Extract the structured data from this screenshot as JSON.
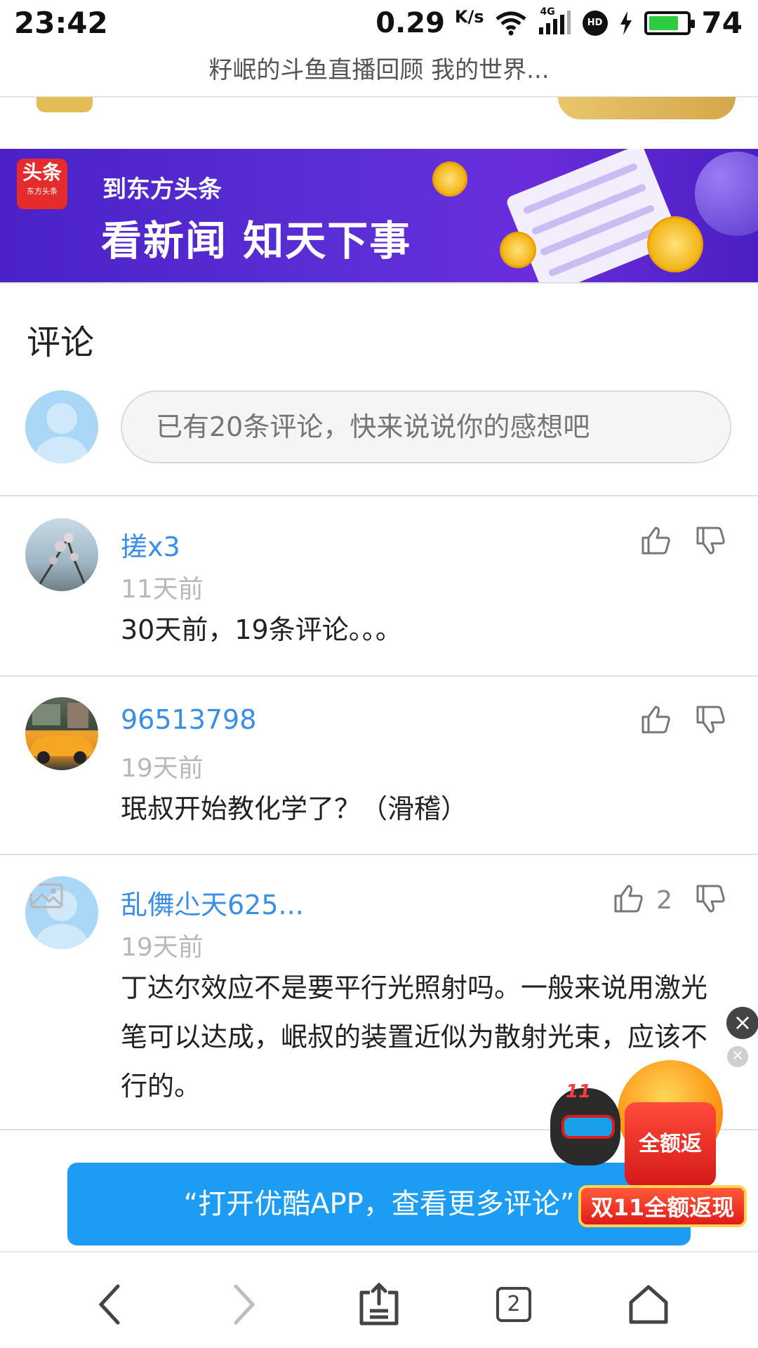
{
  "status_bar": {
    "time": "23:42",
    "network_speed": "0.29",
    "speed_unit_top": "K",
    "speed_unit_bottom": "/s",
    "network_type": "4G",
    "hd_badge": "HD",
    "battery_level": "74",
    "icons": [
      "wifi-icon",
      "signal-icon",
      "hd-icon",
      "charging-icon",
      "battery-icon"
    ]
  },
  "page": {
    "title": "籽岷的斗鱼直播回顾 我的世界..."
  },
  "banner": {
    "logo_text": "头条",
    "logo_subtext": "东方头条",
    "subtitle": "到东方头条",
    "headline": "看新闻 知天下事"
  },
  "comments_section": {
    "title": "评论",
    "input_placeholder": "已有20条评论，快来说说你的感想吧",
    "items": [
      {
        "username": "搓x3",
        "time": "11天前",
        "text": "30天前，19条评论。。。",
        "likes": ""
      },
      {
        "username": "96513798",
        "time": "19天前",
        "text": "珉叔开始教化学了？（滑稽）",
        "likes": ""
      },
      {
        "username": "乱儛尐天625...",
        "time": "19天前",
        "text": "丁达尔效应不是要平行光照射吗。一般来说用激光笔可以达成，岷叔的装置近似为散射光束，应该不行的。",
        "likes": "2"
      }
    ]
  },
  "open_app_button": "“打开优酷APP，查看更多评论”",
  "promo": {
    "box_label": "全额返",
    "ribbon_label": "双11全额返现",
    "cat_badge": "11",
    "close_symbol": "×"
  },
  "navbar": {
    "tab_count": "2",
    "icons": [
      "back-icon",
      "forward-icon",
      "share-icon",
      "tabs-icon",
      "home-icon"
    ]
  },
  "colors": {
    "link_blue": "#3a8ee6",
    "button_blue": "#1c9cf2",
    "banner_purple": "#5a2fd6",
    "promo_red": "#e11b1b"
  }
}
